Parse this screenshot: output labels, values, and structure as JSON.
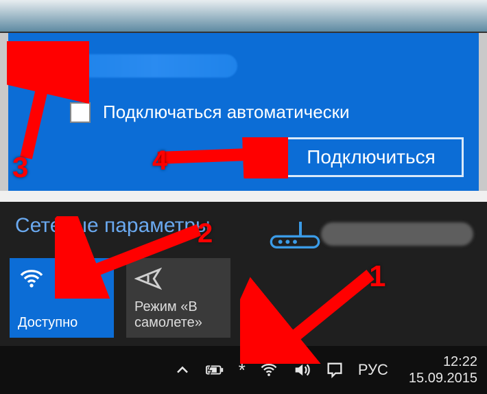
{
  "network": {
    "autoconnect_label": "Подключаться автоматически",
    "connect_button": "Подключиться"
  },
  "settings": {
    "title": "Сетевые параметры",
    "wifi_tile_label": "Доступно",
    "airplane_tile_label": "Режим «В самолете»"
  },
  "taskbar": {
    "language": "РУС",
    "time": "12:22",
    "date": "15.09.2015"
  },
  "annotations": {
    "n1": "1",
    "n2": "2",
    "n3": "3",
    "n4": "4"
  }
}
